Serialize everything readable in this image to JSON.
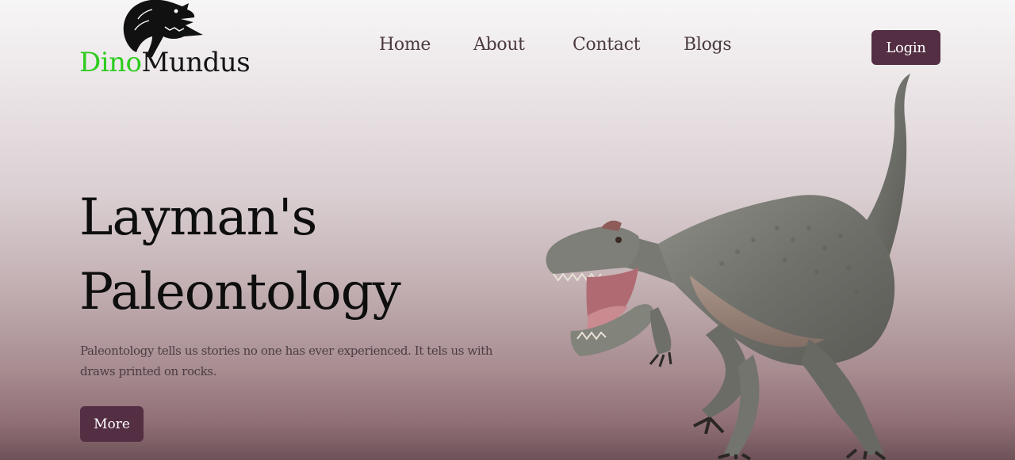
{
  "brand": {
    "name_part1": "Dino",
    "name_part2": "Mundus",
    "icon": "t-rex-head-icon",
    "accent_green": "#2ecc1f"
  },
  "nav": {
    "items": [
      {
        "label": "Home"
      },
      {
        "label": "About"
      },
      {
        "label": "Contact"
      },
      {
        "label": "Blogs"
      }
    ]
  },
  "header": {
    "login_label": "Login"
  },
  "hero": {
    "title_line1": "Layman's",
    "title_line2": "Paleontology",
    "description": "Paleontology tells us stories no one has ever experienced. It tels us with draws printed on rocks.",
    "more_label": "More",
    "image": "allosaurus-dinosaur-image"
  },
  "colors": {
    "button_bg": "#542e43",
    "text_dark": "#0e0e0e",
    "nav_text": "#4a3a40"
  }
}
